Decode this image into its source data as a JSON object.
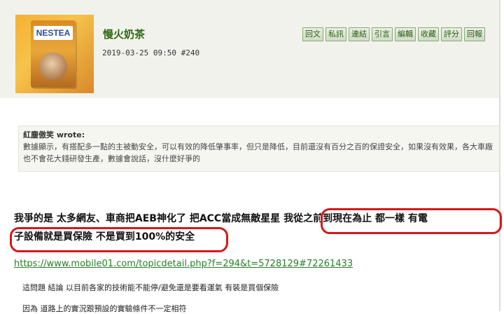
{
  "post": {
    "username": "慢火奶茶",
    "timestamp": "2019-03-25 09:50",
    "post_number": "#240",
    "avatar_logo_text": "NESTEA",
    "actions": [
      "回文",
      "私訊",
      "連結",
      "引言",
      "編輯",
      "收藏",
      "評分",
      "回報"
    ]
  },
  "quote": {
    "author": "紅塵傲笑 wrote:",
    "text": "數據顯示，有搭配多一點的主被動安全，可以有效的降低肇事率，但只是降低，目前還沒有百分之百的保證安全，如果沒有效果，各大車廠也不會花大錢研發生產，數據會說話，沒什麼好爭的"
  },
  "body": {
    "line1": "我爭的是 太多網友、車商把AEB神化了 把ACC當成無敵星星 我從之前到現在為止 都一樣 有電",
    "line2": "子設備就是買保險 不是買到100%的安全",
    "link": "https://www.mobile01.com/topicdetail.php?f=294&t=5728129#72261433",
    "para1": "這問題 結論 以目前各家的技術能不能停/避免還是要看運氣 有裝是買個保險",
    "para2": "因為 道路上的實況跟預設的實驗條件不一定相符"
  },
  "colors": {
    "username": "#2c6a11",
    "link": "#2a7d2a",
    "highlight_circle": "#d4181a",
    "header_bg": "#f2f2ec"
  }
}
